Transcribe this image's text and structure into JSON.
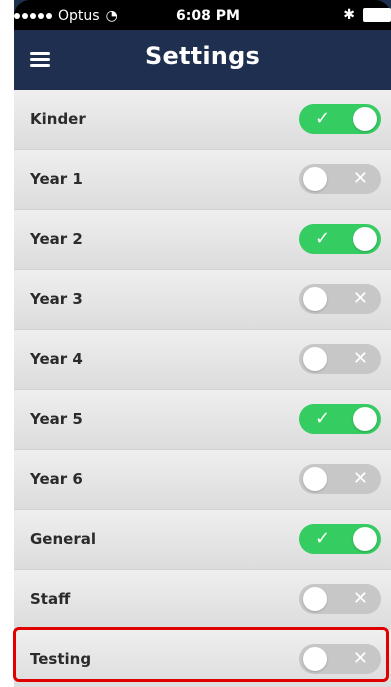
{
  "status_bar": {
    "carrier": "Optus",
    "time": "6:08 PM"
  },
  "header": {
    "title": "Settings",
    "menu_icon": "hamburger-menu-icon"
  },
  "settings": [
    {
      "label": "Kinder",
      "enabled": true
    },
    {
      "label": "Year 1",
      "enabled": false
    },
    {
      "label": "Year 2",
      "enabled": true
    },
    {
      "label": "Year 3",
      "enabled": false
    },
    {
      "label": "Year 4",
      "enabled": false
    },
    {
      "label": "Year 5",
      "enabled": true
    },
    {
      "label": "Year 6",
      "enabled": false
    },
    {
      "label": "General",
      "enabled": true
    },
    {
      "label": "Staff",
      "enabled": false
    },
    {
      "label": "Testing",
      "enabled": false
    }
  ],
  "icons": {
    "toggle_on_mark": "✓",
    "toggle_off_mark": "✕"
  },
  "colors": {
    "header_bg": "#1f2f4f",
    "toggle_on": "#35cc62",
    "toggle_off": "#c7c7c7",
    "highlight": "#e00000"
  }
}
